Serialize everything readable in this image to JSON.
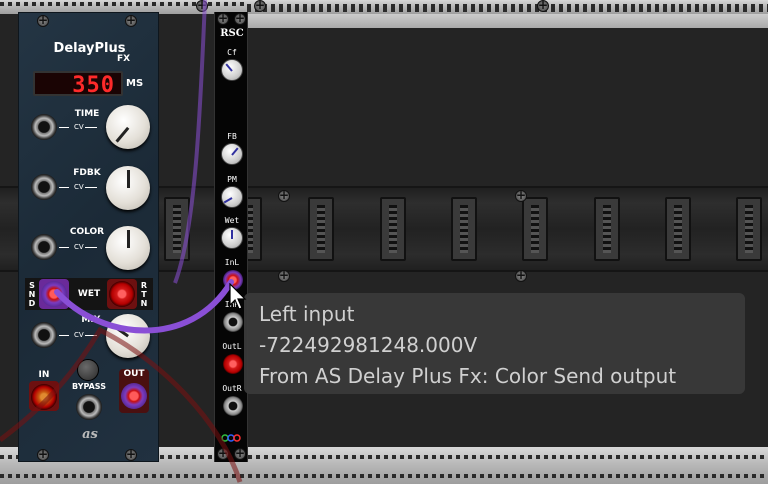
{
  "delayplus": {
    "title": "DelayPlus",
    "subtitle": "FX",
    "display_value": "350",
    "display_unit": "MS",
    "time_label": "TIME",
    "fdbk_label": "FDBK",
    "color_label": "COLOR",
    "mix_label": "MIX",
    "cv_label": "CV",
    "send_label": "SND",
    "wet_label": "WET",
    "return_label": "RTN",
    "in_label": "IN",
    "bypass_label": "BYPASS",
    "out_label": "OUT",
    "logo_text": "as"
  },
  "rsc": {
    "title": "RSC",
    "cf_label": "Cf",
    "fb_label": "FB",
    "pm_label": "PM",
    "wet_label": "Wet",
    "inl_label": "InL",
    "inr_label": "InR",
    "outl_label": "OutL",
    "outr_label": "OutR"
  },
  "tooltip": {
    "line1": "Left input",
    "line2": "-722492981248.000V",
    "line3": "From AS Delay Plus Fx: Color Send output"
  },
  "colors": {
    "cable_purple": "#8a4fd6",
    "cable_red": "#b01818",
    "display_red": "#ff2a2a"
  }
}
